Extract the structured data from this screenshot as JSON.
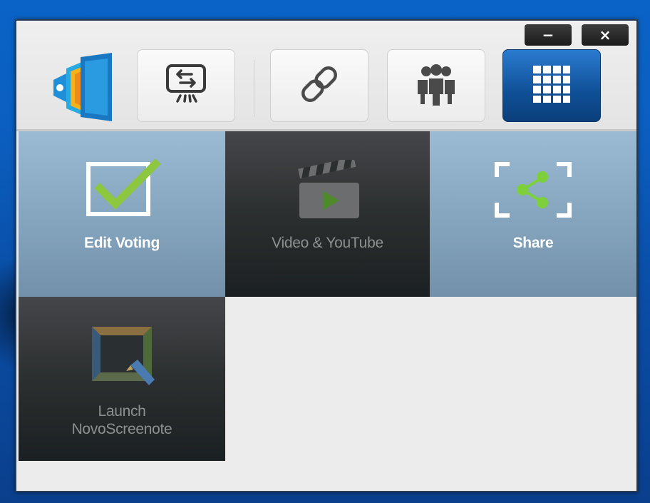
{
  "window": {
    "minimize_label": "−",
    "close_label": "×",
    "logo_icon": "novo-logo-icon"
  },
  "toolbar": {
    "buttons": [
      {
        "icon": "screen-mirror-icon",
        "active": false
      },
      {
        "icon": "link-icon",
        "active": false
      },
      {
        "icon": "users-group-icon",
        "active": false
      },
      {
        "icon": "apps-grid-icon",
        "active": true
      }
    ]
  },
  "tiles": [
    {
      "label": "Edit Voting",
      "icon": "checkbox-check-icon",
      "style": "light"
    },
    {
      "label": "Video & YouTube",
      "icon": "video-clapper-icon",
      "style": "dark"
    },
    {
      "label": "Share",
      "icon": "share-icon",
      "style": "light"
    },
    {
      "label_line1": "Launch",
      "label_line2": "NovoScreenote",
      "icon": "screenote-icon",
      "style": "dark"
    }
  ],
  "colors": {
    "accent_blue": "#1a5fa8",
    "check_green": "#8dc63f",
    "share_green": "#7ed03a",
    "tile_light": "#8aa9c2",
    "tile_dark": "#2c2f30"
  }
}
